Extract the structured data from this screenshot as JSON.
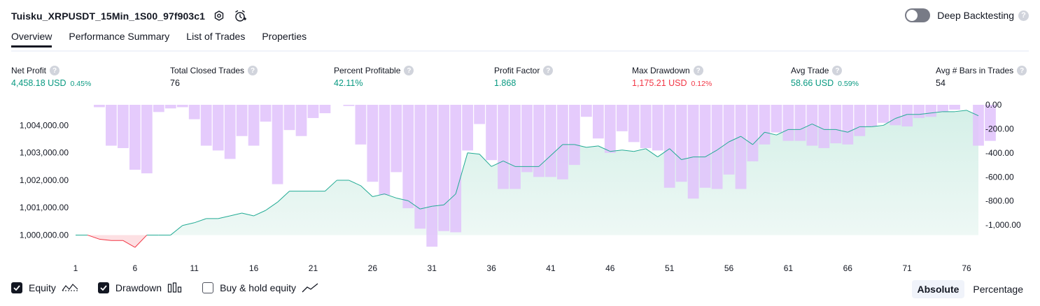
{
  "header": {
    "strategy_title": "Tuisku_XRPUSDT_15Min_1S00_97f903c1",
    "icons": [
      "settings-icon",
      "alert-add-icon"
    ],
    "deep_backtesting_label": "Deep Backtesting",
    "deep_backtesting_enabled": false,
    "help_glyph": "?"
  },
  "tabs": [
    {
      "label": "Overview",
      "active": true
    },
    {
      "label": "Performance Summary",
      "active": false
    },
    {
      "label": "List of Trades",
      "active": false
    },
    {
      "label": "Properties",
      "active": false
    }
  ],
  "metrics": {
    "net_profit": {
      "label": "Net Profit",
      "value": "4,458.18 USD",
      "pct": "0.45%"
    },
    "total_closed_trades": {
      "label": "Total Closed Trades",
      "value": "76"
    },
    "percent_profitable": {
      "label": "Percent Profitable",
      "value": "42.11%"
    },
    "profit_factor": {
      "label": "Profit Factor",
      "value": "1.868"
    },
    "max_drawdown": {
      "label": "Max Drawdown",
      "value": "1,175.21 USD",
      "pct": "0.12%"
    },
    "avg_trade": {
      "label": "Avg Trade",
      "value": "58.66 USD",
      "pct": "0.59%"
    },
    "avg_bars": {
      "label": "Avg # Bars in Trades",
      "value": "54"
    }
  },
  "colors": {
    "green": "#089981",
    "red": "#f23645",
    "drawdown_bar": "#e1c2fb",
    "equity_line": "#22ab94",
    "equity_fill": "#d5f0e8",
    "equity_loss_line": "#f23645",
    "text": "#131722",
    "axis_text": "#131722"
  },
  "chart_data": {
    "type": "area",
    "x_ticks": [
      "1",
      "6",
      "11",
      "16",
      "21",
      "26",
      "31",
      "36",
      "41",
      "46",
      "51",
      "56",
      "61",
      "66",
      "71",
      "76"
    ],
    "x_range": [
      1,
      77
    ],
    "left_axis": {
      "ticks": [
        "1,000,000.00",
        "1,001,000.00",
        "1,002,000.00",
        "1,003,000.00",
        "1,004,000.00"
      ],
      "ylim": [
        999400,
        1004750
      ]
    },
    "right_axis": {
      "ticks": [
        "0.00",
        "-200.00",
        "-400.00",
        "-600.00",
        "-800.00",
        "-1,000.00"
      ],
      "ylim": [
        -1220,
        0
      ]
    },
    "baseline": 1000000,
    "series": [
      {
        "name": "Equity",
        "values": [
          1000000,
          1000000,
          999850,
          999800,
          999800,
          999550,
          1000000,
          1000000,
          1000000,
          1000350,
          1000450,
          1000600,
          1000600,
          1000700,
          1000800,
          1000700,
          1000900,
          1001200,
          1001600,
          1001600,
          1001600,
          1001600,
          1002000,
          1002000,
          1001800,
          1001400,
          1001500,
          1001350,
          1001250,
          1000950,
          1001050,
          1001100,
          1001500,
          1003000,
          1002950,
          1002500,
          1002700,
          1002500,
          1002500,
          1002500,
          1002900,
          1003300,
          1003300,
          1003200,
          1003250,
          1003050,
          1003100,
          1003050,
          1003150,
          1002850,
          1003150,
          1002750,
          1002850,
          1002850,
          1003100,
          1003400,
          1003600,
          1003300,
          1003750,
          1003650,
          1003850,
          1003850,
          1004050,
          1003850,
          1003850,
          1003750,
          1003950,
          1003950,
          1004000,
          1004250,
          1004400,
          1004400,
          1004450,
          1004500,
          1004500,
          1004550,
          1004350
        ]
      },
      {
        "name": "Drawdown",
        "values": [
          0,
          0,
          -20,
          -340,
          -360,
          -540,
          -570,
          -60,
          -30,
          -20,
          -120,
          -340,
          -380,
          -450,
          -260,
          -340,
          -140,
          -660,
          -210,
          -260,
          -110,
          -70,
          0,
          -10,
          -330,
          -640,
          -750,
          -560,
          -860,
          -1030,
          -1180,
          -1050,
          -1060,
          -380,
          -160,
          -460,
          -700,
          -700,
          -560,
          -600,
          -600,
          -620,
          -500,
          -100,
          -280,
          -400,
          -220,
          -310,
          -360,
          -380,
          -690,
          -640,
          -780,
          -690,
          -700,
          -580,
          -700,
          -470,
          -330,
          -230,
          -300,
          -300,
          -340,
          -360,
          -320,
          -330,
          -260,
          -180,
          -150,
          -170,
          -180,
          -110,
          -100,
          -60,
          -40,
          0,
          -340,
          -300
        ]
      }
    ]
  },
  "legend": {
    "equity": {
      "label": "Equity",
      "checked": true
    },
    "drawdown": {
      "label": "Drawdown",
      "checked": true
    },
    "buy_hold": {
      "label": "Buy & hold equity",
      "checked": false
    }
  },
  "mode": {
    "absolute": "Absolute",
    "percentage": "Percentage",
    "selected": "Absolute"
  }
}
